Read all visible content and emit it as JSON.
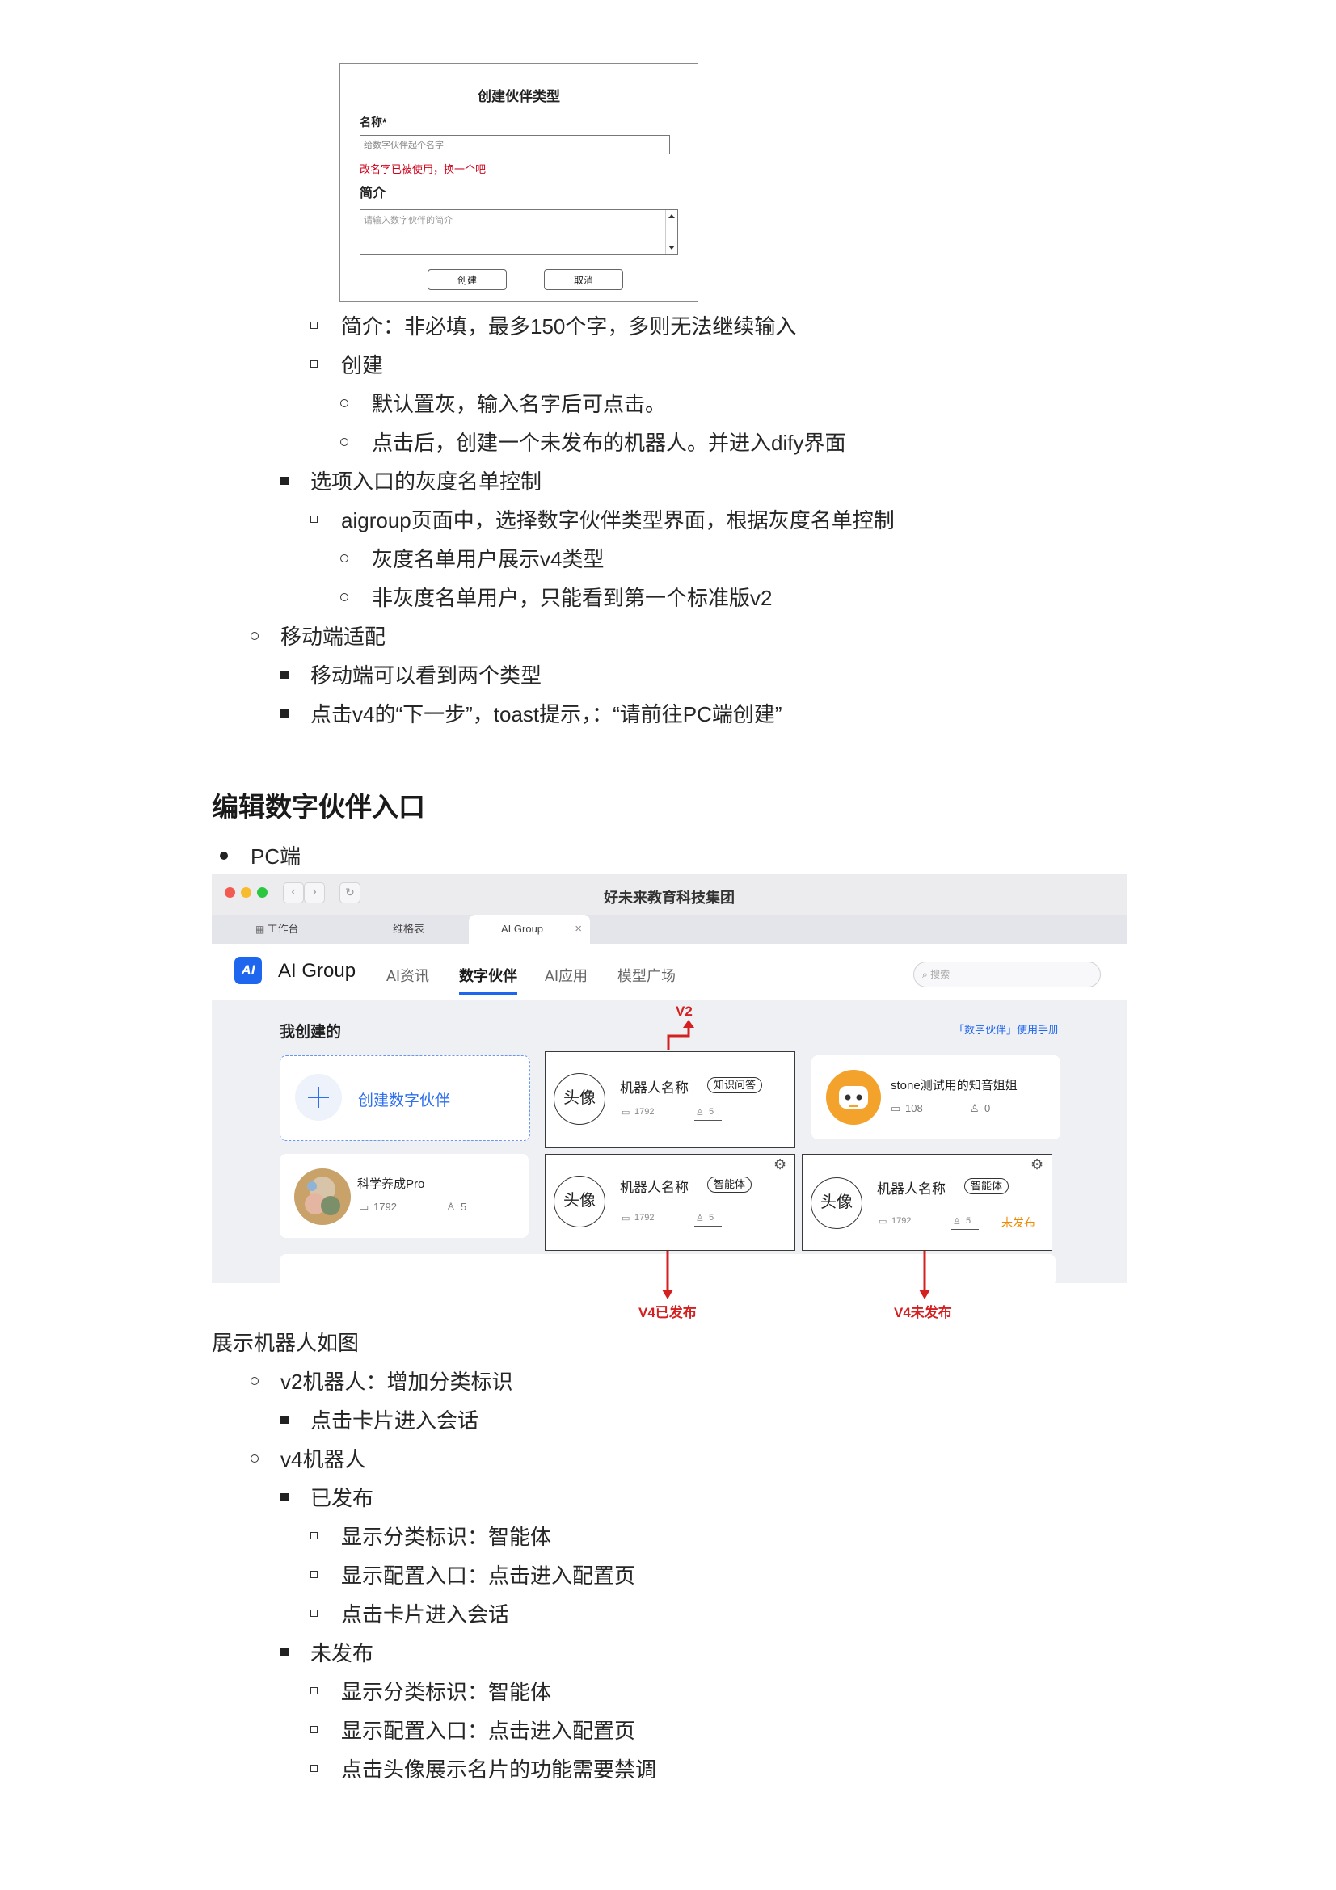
{
  "dialog": {
    "title": "创建伙伴类型",
    "name_label": "名称*",
    "name_placeholder": "给数字伙伴起个名字",
    "name_error": "改名字已被使用，换一个吧",
    "intro_label": "简介",
    "intro_placeholder": "请输入数字伙伴的简介",
    "create_button": "创建",
    "cancel_button": "取消"
  },
  "list1": [
    "简介：非必填，最多150个字，多则无法继续输入",
    "创建",
    "默认置灰，输入名字后可点击。",
    "点击后，创建一个未发布的机器人。并进入dify界面",
    "选项入口的灰度名单控制",
    "aigroup页面中，选择数字伙伴类型界面，根据灰度名单控制",
    "灰度名单用户展示v4类型",
    "非灰度名单用户，只能看到第一个标准版v2",
    "移动端适配",
    "移动端可以看到两个类型",
    "点击v4的“下一步”，toast提示，：“请前往PC端创建”"
  ],
  "section_heading": "编辑数字伙伴入口",
  "pc_bullet": "PC端",
  "browser": {
    "window_title": "好未来教育科技集团",
    "tabs": [
      "工作台",
      "维格表",
      "AI Group"
    ],
    "logo_text": "AI",
    "app_name": "AI Group",
    "nav": [
      "AI资讯",
      "数字伙伴",
      "AI应用",
      "模型广场"
    ],
    "search_placeholder": "搜索",
    "section_title": "我创建的",
    "manual_link": "「数字伙伴」使用手册",
    "create_card": "创建数字伙伴",
    "avatar_text": "头像",
    "robot_name": "机器人名称",
    "tag_v2": "知识问答",
    "tag_v4": "智能体",
    "stat_msgs": "1792",
    "stat_users": "5",
    "unpublished": "未发布",
    "card_stone": {
      "name": "stone测试用的知音姐姐",
      "msgs": "108",
      "users": "0"
    },
    "card_pro": {
      "name": "科学养成Pro",
      "msgs": "1792",
      "users": "5"
    }
  },
  "annotations": {
    "v2": "V2",
    "v4_published": "V4已发布",
    "v4_unpublished": "V4未发布"
  },
  "list2_intro": "展示机器人如图",
  "list2": [
    "v2机器人：增加分类标识",
    "点击卡片进入会话",
    "v4机器人",
    "已发布",
    "显示分类标识：智能体",
    "显示配置入口：点击进入配置页",
    "点击卡片进入会话",
    "未发布",
    "显示分类标识：智能体",
    "显示配置入口：点击进入配置页",
    "点击头像展示名片的功能需要禁调"
  ],
  "colors": {
    "accent": "#1f66ee",
    "error": "#d0021b",
    "annotation": "#d42020",
    "unpublished": "#ef8a00"
  }
}
